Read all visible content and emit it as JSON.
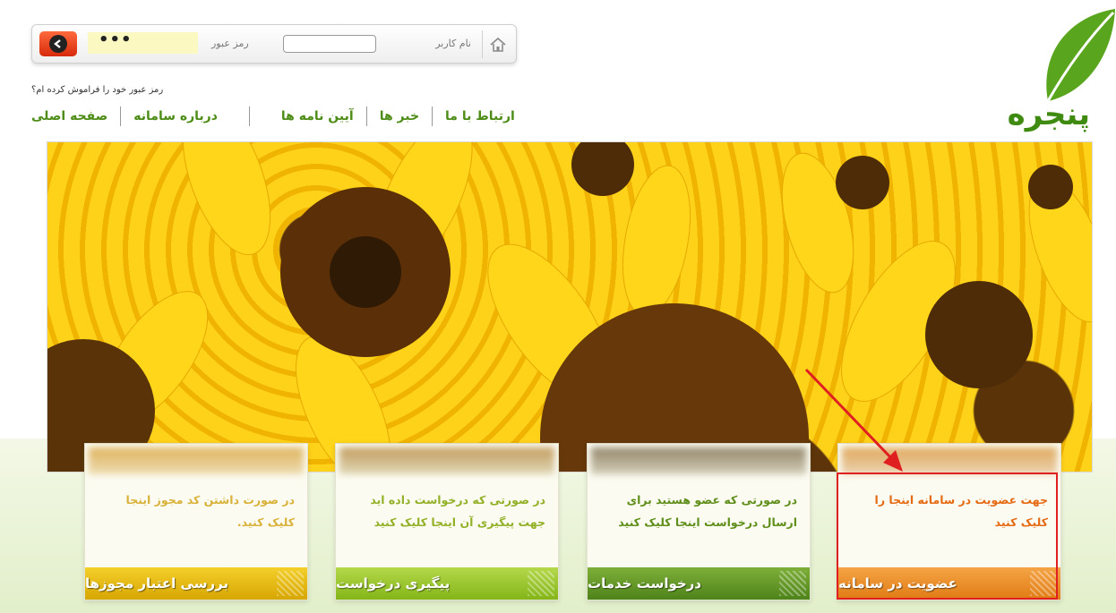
{
  "login": {
    "username_label": "نام کاربر",
    "password_label": "رمز عبور",
    "username_value": "",
    "password_value": "•••",
    "forgot_link": "رمز عبور خود را فراموش کرده ام؟"
  },
  "nav": [
    {
      "label": "صفحه اصلی"
    },
    {
      "label": "درباره سامانه"
    },
    {
      "label": "آیین نامه ها"
    },
    {
      "label": "خبر ها"
    },
    {
      "label": "ارتباط با ما"
    }
  ],
  "logo": {
    "text": "پنجره"
  },
  "boxes": [
    {
      "text": "جهت عضویت در سامانه اینجا را کلیک کنید",
      "button": "عضویت در سامانه",
      "color": "#e07b14"
    },
    {
      "text": "در صورتی که عضو هستید برای ارسال درخواست اینجا کلیک کنید",
      "button": "درخواست خدمات",
      "color": "#4e831a"
    },
    {
      "text": "در صورتی که درخواست داده اید جهت پیگیری آن اینجا کلیک کنید",
      "button": "پیگیری درخواست",
      "color": "#84b518"
    },
    {
      "text": "در صورت داشتن کد مجوز اینجا کلیک کنید.",
      "button": "بررسی اعتبار مجوزها",
      "color": "#d7a603"
    }
  ],
  "colors": {
    "accent": "#4d8c16",
    "highlight": "#e02020"
  }
}
